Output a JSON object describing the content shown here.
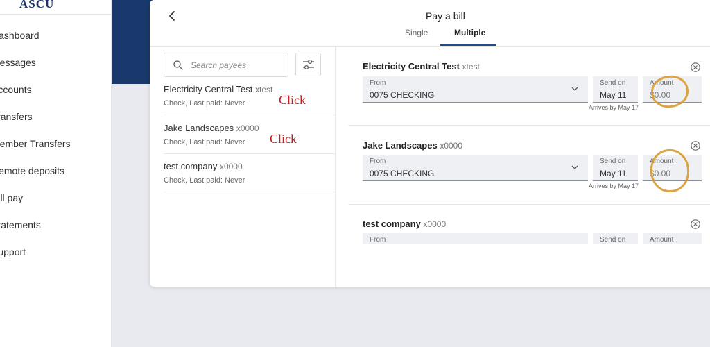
{
  "brand": {
    "logo": "ASCU"
  },
  "sidebar": {
    "items": [
      {
        "label": "Dashboard"
      },
      {
        "label": "Messages"
      },
      {
        "label": "Accounts"
      },
      {
        "label": "Transfers"
      },
      {
        "label": "Member Transfers"
      },
      {
        "label": "Remote deposits"
      },
      {
        "label": "Bill pay"
      },
      {
        "label": "Statements"
      },
      {
        "label": "Support"
      }
    ]
  },
  "dialog": {
    "title": "Pay a bill",
    "tabs": [
      {
        "label": "Single",
        "active": false
      },
      {
        "label": "Multiple",
        "active": true
      }
    ],
    "back_icon": "chevron-left-icon"
  },
  "search": {
    "placeholder": "Search payees",
    "value": ""
  },
  "payees": [
    {
      "name": "Electricity Central Test",
      "account": "xtest",
      "status": "Check, Last paid: Never"
    },
    {
      "name": "Jake Landscapes",
      "account": "x0000",
      "status": "Check, Last paid: Never"
    },
    {
      "name": "test company",
      "account": "x0000",
      "status": "Check, Last paid: Never"
    }
  ],
  "annotations": {
    "click_label": "Click",
    "color": "#c41f1f",
    "circle_color": "#d89a2e"
  },
  "entries": [
    {
      "name": "Electricity Central Test",
      "account": "xtest",
      "from_label": "From",
      "from_value": "0075 CHECKING",
      "send_label": "Send on",
      "send_value": "May 11",
      "amount_label": "Amount",
      "amount_value": "$0.00",
      "arrives": "Arrives by May 17"
    },
    {
      "name": "Jake Landscapes",
      "account": "x0000",
      "from_label": "From",
      "from_value": "0075 CHECKING",
      "send_label": "Send on",
      "send_value": "May 11",
      "amount_label": "Amount",
      "amount_value": "$0.00",
      "arrives": "Arrives by May 17"
    },
    {
      "name": "test company",
      "account": "x0000",
      "from_label": "From",
      "send_label": "Send on",
      "amount_label": "Amount"
    }
  ],
  "colors": {
    "navy": "#19386b",
    "accent": "#1d4e8f",
    "background": "#e8eaf0"
  }
}
